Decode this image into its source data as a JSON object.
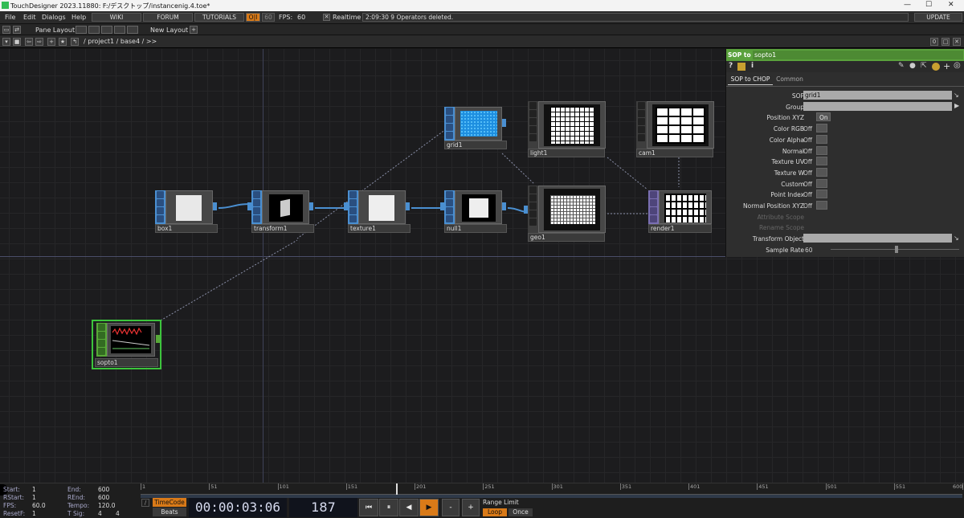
{
  "window": {
    "title": "TouchDesigner 2023.11880: F:/デスクトップ/instancenig.4.toe*",
    "minimize": "—",
    "maximize": "☐",
    "close": "✕"
  },
  "menu": {
    "file": "File",
    "edit": "Edit",
    "dialogs": "Dialogs",
    "help": "Help",
    "wiki": "WIKI",
    "forum": "FORUM",
    "tutorials": "TUTORIALS",
    "oi": "O|I",
    "sixty": "60",
    "fps_label": "FPS:",
    "fps_value": "60",
    "realtime": "Realtime",
    "status": "2:09:30 9 Operators deleted.",
    "update": "UPDATE"
  },
  "pane": {
    "pane_layout": "Pane Layout",
    "new_layout": "New Layout",
    "add": "+"
  },
  "path": {
    "text": "/ project1 / base4 / >>",
    "zero": "0"
  },
  "nodes": {
    "box1": "box1",
    "transform1": "transform1",
    "texture1": "texture1",
    "null1": "null1",
    "grid1": "grid1",
    "light1": "light1",
    "cam1": "cam1",
    "geo1": "geo1",
    "render1": "render1",
    "sopto1": "sopto1"
  },
  "params": {
    "op_type": "SOP to",
    "op_name": "sopto1",
    "tab1": "SOP to CHOP",
    "tab2": "Common",
    "rows": [
      {
        "label": "SOP",
        "value": "grid1",
        "kind": "field"
      },
      {
        "label": "Group",
        "value": "",
        "kind": "field"
      },
      {
        "label": "Position XYZ",
        "value": "On",
        "kind": "toggle"
      },
      {
        "label": "Color RGB",
        "value": "Off",
        "kind": "toggle"
      },
      {
        "label": "Color Alpha",
        "value": "Off",
        "kind": "toggle"
      },
      {
        "label": "Normal",
        "value": "Off",
        "kind": "toggle"
      },
      {
        "label": "Texture UV",
        "value": "Off",
        "kind": "toggle"
      },
      {
        "label": "Texture W",
        "value": "Off",
        "kind": "toggle"
      },
      {
        "label": "Custom",
        "value": "Off",
        "kind": "toggle"
      },
      {
        "label": "Point Index",
        "value": "Off",
        "kind": "toggle"
      },
      {
        "label": "Normal Position XYZ",
        "value": "Off",
        "kind": "toggle"
      },
      {
        "label": "Attribute Scope",
        "value": "",
        "kind": "disabled"
      },
      {
        "label": "Rename Scope",
        "value": "",
        "kind": "disabled"
      },
      {
        "label": "Transform Object",
        "value": "",
        "kind": "field"
      },
      {
        "label": "Sample Rate",
        "value": "60",
        "kind": "slider"
      }
    ]
  },
  "time": {
    "start_l": "Start:",
    "start_v": "1",
    "rstart_l": "RStart:",
    "rstart_v": "1",
    "fps_l": "FPS:",
    "fps_v": "60.0",
    "resetf_l": "ResetF:",
    "resetf_v": "1",
    "end_l": "End:",
    "end_v": "600",
    "rend_l": "REnd:",
    "rend_v": "600",
    "tempo_l": "Tempo:",
    "tempo_v": "120.0",
    "tsig_l": "T Sig:",
    "tsig_v1": "4",
    "tsig_v2": "4",
    "ticks": [
      "1",
      "51",
      "101",
      "151",
      "201",
      "251",
      "301",
      "351",
      "401",
      "451",
      "501",
      "551",
      "600"
    ],
    "current_frame": 187,
    "frame_range": [
      1,
      600
    ],
    "timecode_label": "TimeCode",
    "beats_label": "Beats",
    "timecode": "00:00:03:06",
    "frame": "187",
    "range_limit": "Range Limit",
    "loop": "Loop",
    "once": "Once",
    "minus": "-",
    "plus": "+"
  }
}
